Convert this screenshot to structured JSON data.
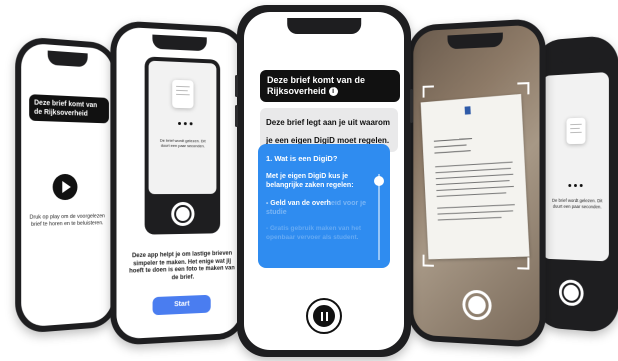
{
  "phone1": {
    "title": "Deze brief komt van de Rijksoverheid",
    "instruction": "Druk op play om de voorgelezen brief te horen en te beluisteren."
  },
  "phone2": {
    "doc_caption": "De brief wordt gelezen. Dit duurt een paar seconden.",
    "intro": "Deze app helpt je om lastige brieven simpeler te maken. Het enige wat jij hoeft te doen is een foto te maken van de brief.",
    "start_label": "Start"
  },
  "phone3": {
    "title": "Deze brief komt van de Rijksoverheid",
    "info_icon": "i",
    "bubble": "Deze brief legt aan je uit waarom je een eigen DigiD moet regelen.",
    "card_heading": "1. Wat is een DigiD?",
    "card_body": "Met je eigen DigiD kus je belangrijke zaken regelen:",
    "card_item1": "- Geld van de overh",
    "card_item1_faded": "eid voor je studie",
    "card_item2_faded": "- Gratis gebruik maken van het openbaar vervoer als student."
  },
  "phone4": {},
  "phone5": {
    "doc_caption": "De brief wordt gelezen. Dit duurt een paar seconden."
  },
  "colors": {
    "accent_blue": "#2f8cf0",
    "start_blue": "#4a7df0",
    "phone_frame": "#1e1e20"
  }
}
